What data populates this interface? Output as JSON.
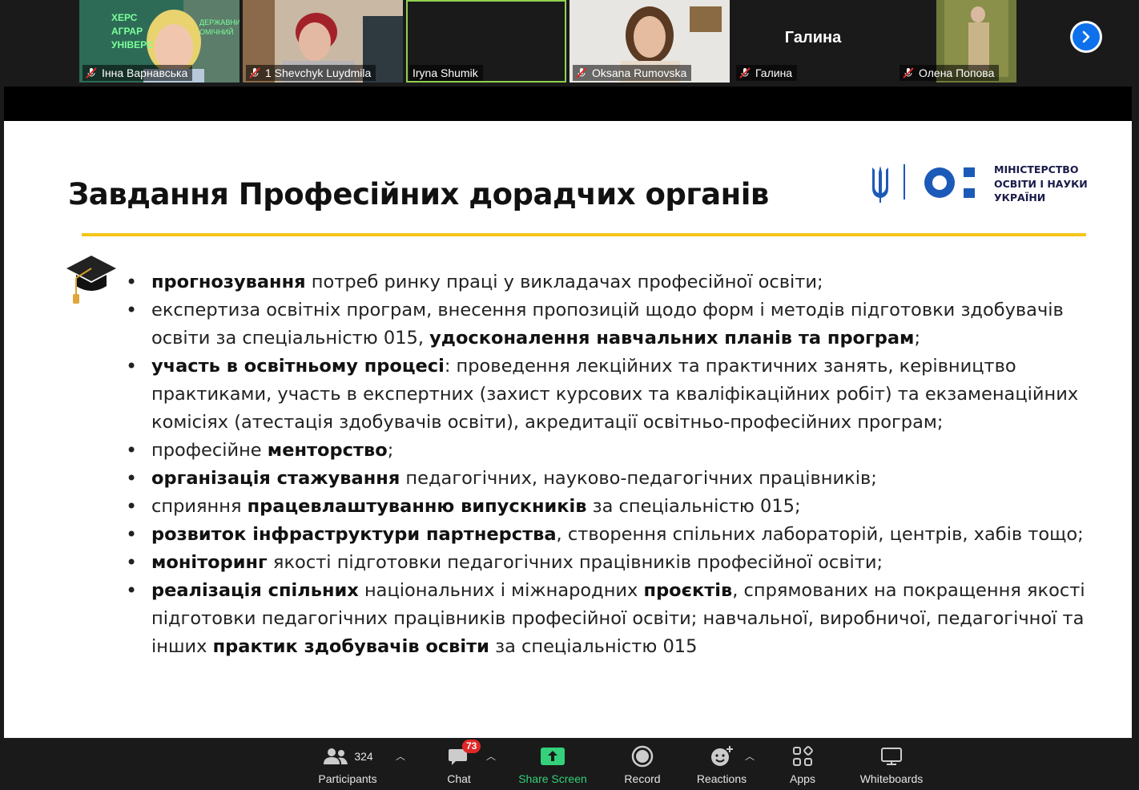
{
  "gallery": {
    "participants": [
      {
        "name": "Інна Варнавська",
        "muted": true,
        "active": false,
        "video": true,
        "sign_text": "ХЕРС АГРАР УНІВЕРС ДЕРЖАВНИЙ ОМІЧНИЙ"
      },
      {
        "name": "1  Shevchyk  Luydmila",
        "muted": true,
        "active": false,
        "video": true
      },
      {
        "name": "Iryna Shumik",
        "muted": false,
        "active": true,
        "video": true
      },
      {
        "name": "Oksana Rumovska",
        "muted": true,
        "active": false,
        "video": true
      },
      {
        "name": "Галина",
        "muted": true,
        "active": false,
        "video": false,
        "display_name": "Галина"
      },
      {
        "name": "Олена Попова",
        "muted": true,
        "active": false,
        "video": true
      }
    ]
  },
  "slide": {
    "title": "Завдання Професійних дорадчих органів",
    "logo_text": [
      "МІНІСТЕРСТВО",
      "ОСВІТИ І НАУКИ",
      "УКРАЇНИ"
    ],
    "bullets": [
      [
        {
          "t": "прогнозування",
          "b": true
        },
        {
          "t": " потреб ринку праці у викладачах професійної освіти;",
          "b": false
        }
      ],
      [
        {
          "t": "експертиза освітніх програм, внесення пропозицій щодо форм і методів підготовки здобувачів освіти за спеціальністю 015, ",
          "b": false
        },
        {
          "t": "удосконалення навчальних планів та програм",
          "b": true
        },
        {
          "t": ";",
          "b": false
        }
      ],
      [
        {
          "t": "участь в освітньому процесі",
          "b": true
        },
        {
          "t": ": проведення лекційних та практичних занять, керівництво практиками, участь в експертних (захист курсових та кваліфікаційних робіт) та екзаменаційних комісіях (атестація здобувачів освіти), акредитації освітньо-професійних програм;",
          "b": false
        }
      ],
      [
        {
          "t": "професійне ",
          "b": false
        },
        {
          "t": "менторство",
          "b": true
        },
        {
          "t": ";",
          "b": false
        }
      ],
      [
        {
          "t": "організація стажування",
          "b": true
        },
        {
          "t": " педагогічних, науково-педагогічних працівників;",
          "b": false
        }
      ],
      [
        {
          "t": "сприяння ",
          "b": false
        },
        {
          "t": "працевлаштуванню випускників",
          "b": true
        },
        {
          "t": " за спеціальністю 015;",
          "b": false
        }
      ],
      [
        {
          "t": "розвиток інфраструктури партнерства",
          "b": true
        },
        {
          "t": ", створення спільних лабораторій, центрів, хабів тощо;",
          "b": false
        }
      ],
      [
        {
          "t": "моніторинг",
          "b": true
        },
        {
          "t": " якості підготовки педагогічних працівників професійної освіти;",
          "b": false
        }
      ],
      [
        {
          "t": "реалізація спільних",
          "b": true
        },
        {
          "t": " національних і міжнародних ",
          "b": false
        },
        {
          "t": "проєктів",
          "b": true
        },
        {
          "t": ", спрямованих на покращення якості підготовки педагогічних працівників професійної освіти; навчальної, виробничої, педагогічної та інших ",
          "b": false
        },
        {
          "t": "практик здобувачів освіти",
          "b": true
        },
        {
          "t": " за спеціальністю 015",
          "b": false
        }
      ]
    ]
  },
  "toolbar": {
    "participants_label": "Participants",
    "participants_count": "324",
    "chat_label": "Chat",
    "chat_badge": "73",
    "share_label": "Share Screen",
    "record_label": "Record",
    "reactions_label": "Reactions",
    "apps_label": "Apps",
    "whiteboards_label": "Whiteboards"
  },
  "colors": {
    "accent_green": "#33d17a",
    "zoom_blue": "#0e71eb",
    "title_underline": "#f5c518",
    "badge_red": "#e02828",
    "mute_red": "#e02828"
  }
}
